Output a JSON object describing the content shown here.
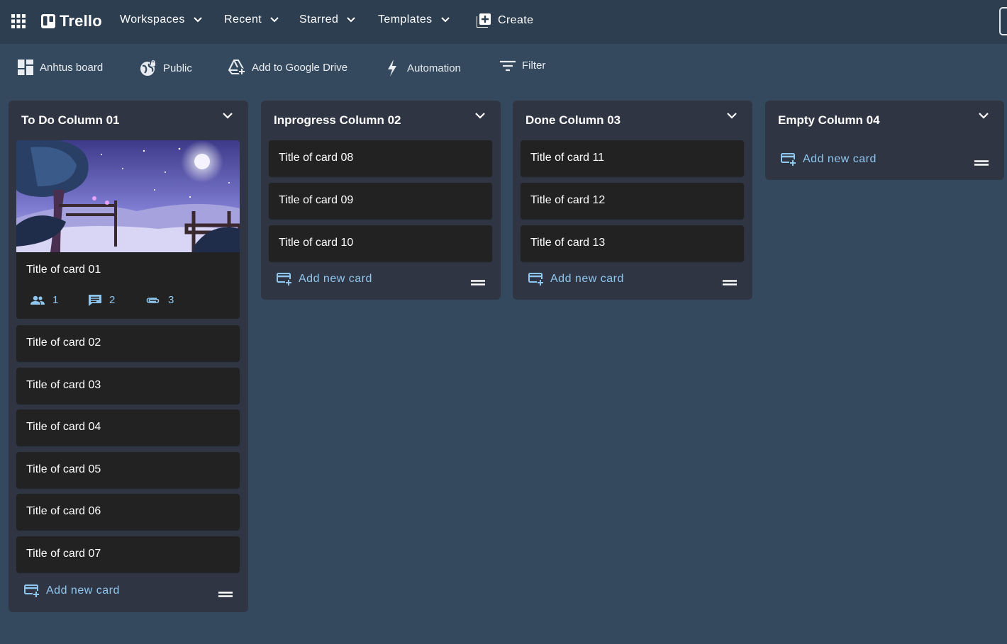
{
  "app": {
    "name": "Trello"
  },
  "nav": {
    "workspaces": "Workspaces",
    "recent": "Recent",
    "starred": "Starred",
    "templates": "Templates",
    "create": "Create"
  },
  "boardbar": {
    "board_name": "Anhtus board",
    "visibility": "Public",
    "drive": "Add to Google Drive",
    "automation": "Automation",
    "filter": "Filter"
  },
  "columns": [
    {
      "title": "To Do Column 01",
      "cover_card": {
        "title": "Title of card 01",
        "members": "1",
        "comments": "2",
        "attachments": "3"
      },
      "cards": [
        "Title of card 02",
        "Title of card 03",
        "Title of card 04",
        "Title of card 05",
        "Title of card 06",
        "Title of card 07"
      ],
      "add_label": "Add new card"
    },
    {
      "title": "Inprogress Column 02",
      "cards": [
        "Title of card 08",
        "Title of card 09",
        "Title of card 10"
      ],
      "add_label": "Add new card"
    },
    {
      "title": "Done Column 03",
      "cards": [
        "Title of card 11",
        "Title of card 12",
        "Title of card 13"
      ],
      "add_label": "Add new card"
    },
    {
      "title": "Empty Column 04",
      "cards": [],
      "add_label": "Add new card"
    }
  ],
  "colors": {
    "background": "#34495e",
    "appbar": "#2c3e50",
    "column": "#2f3542",
    "card": "#222222",
    "accent": "#8fc7f0"
  }
}
